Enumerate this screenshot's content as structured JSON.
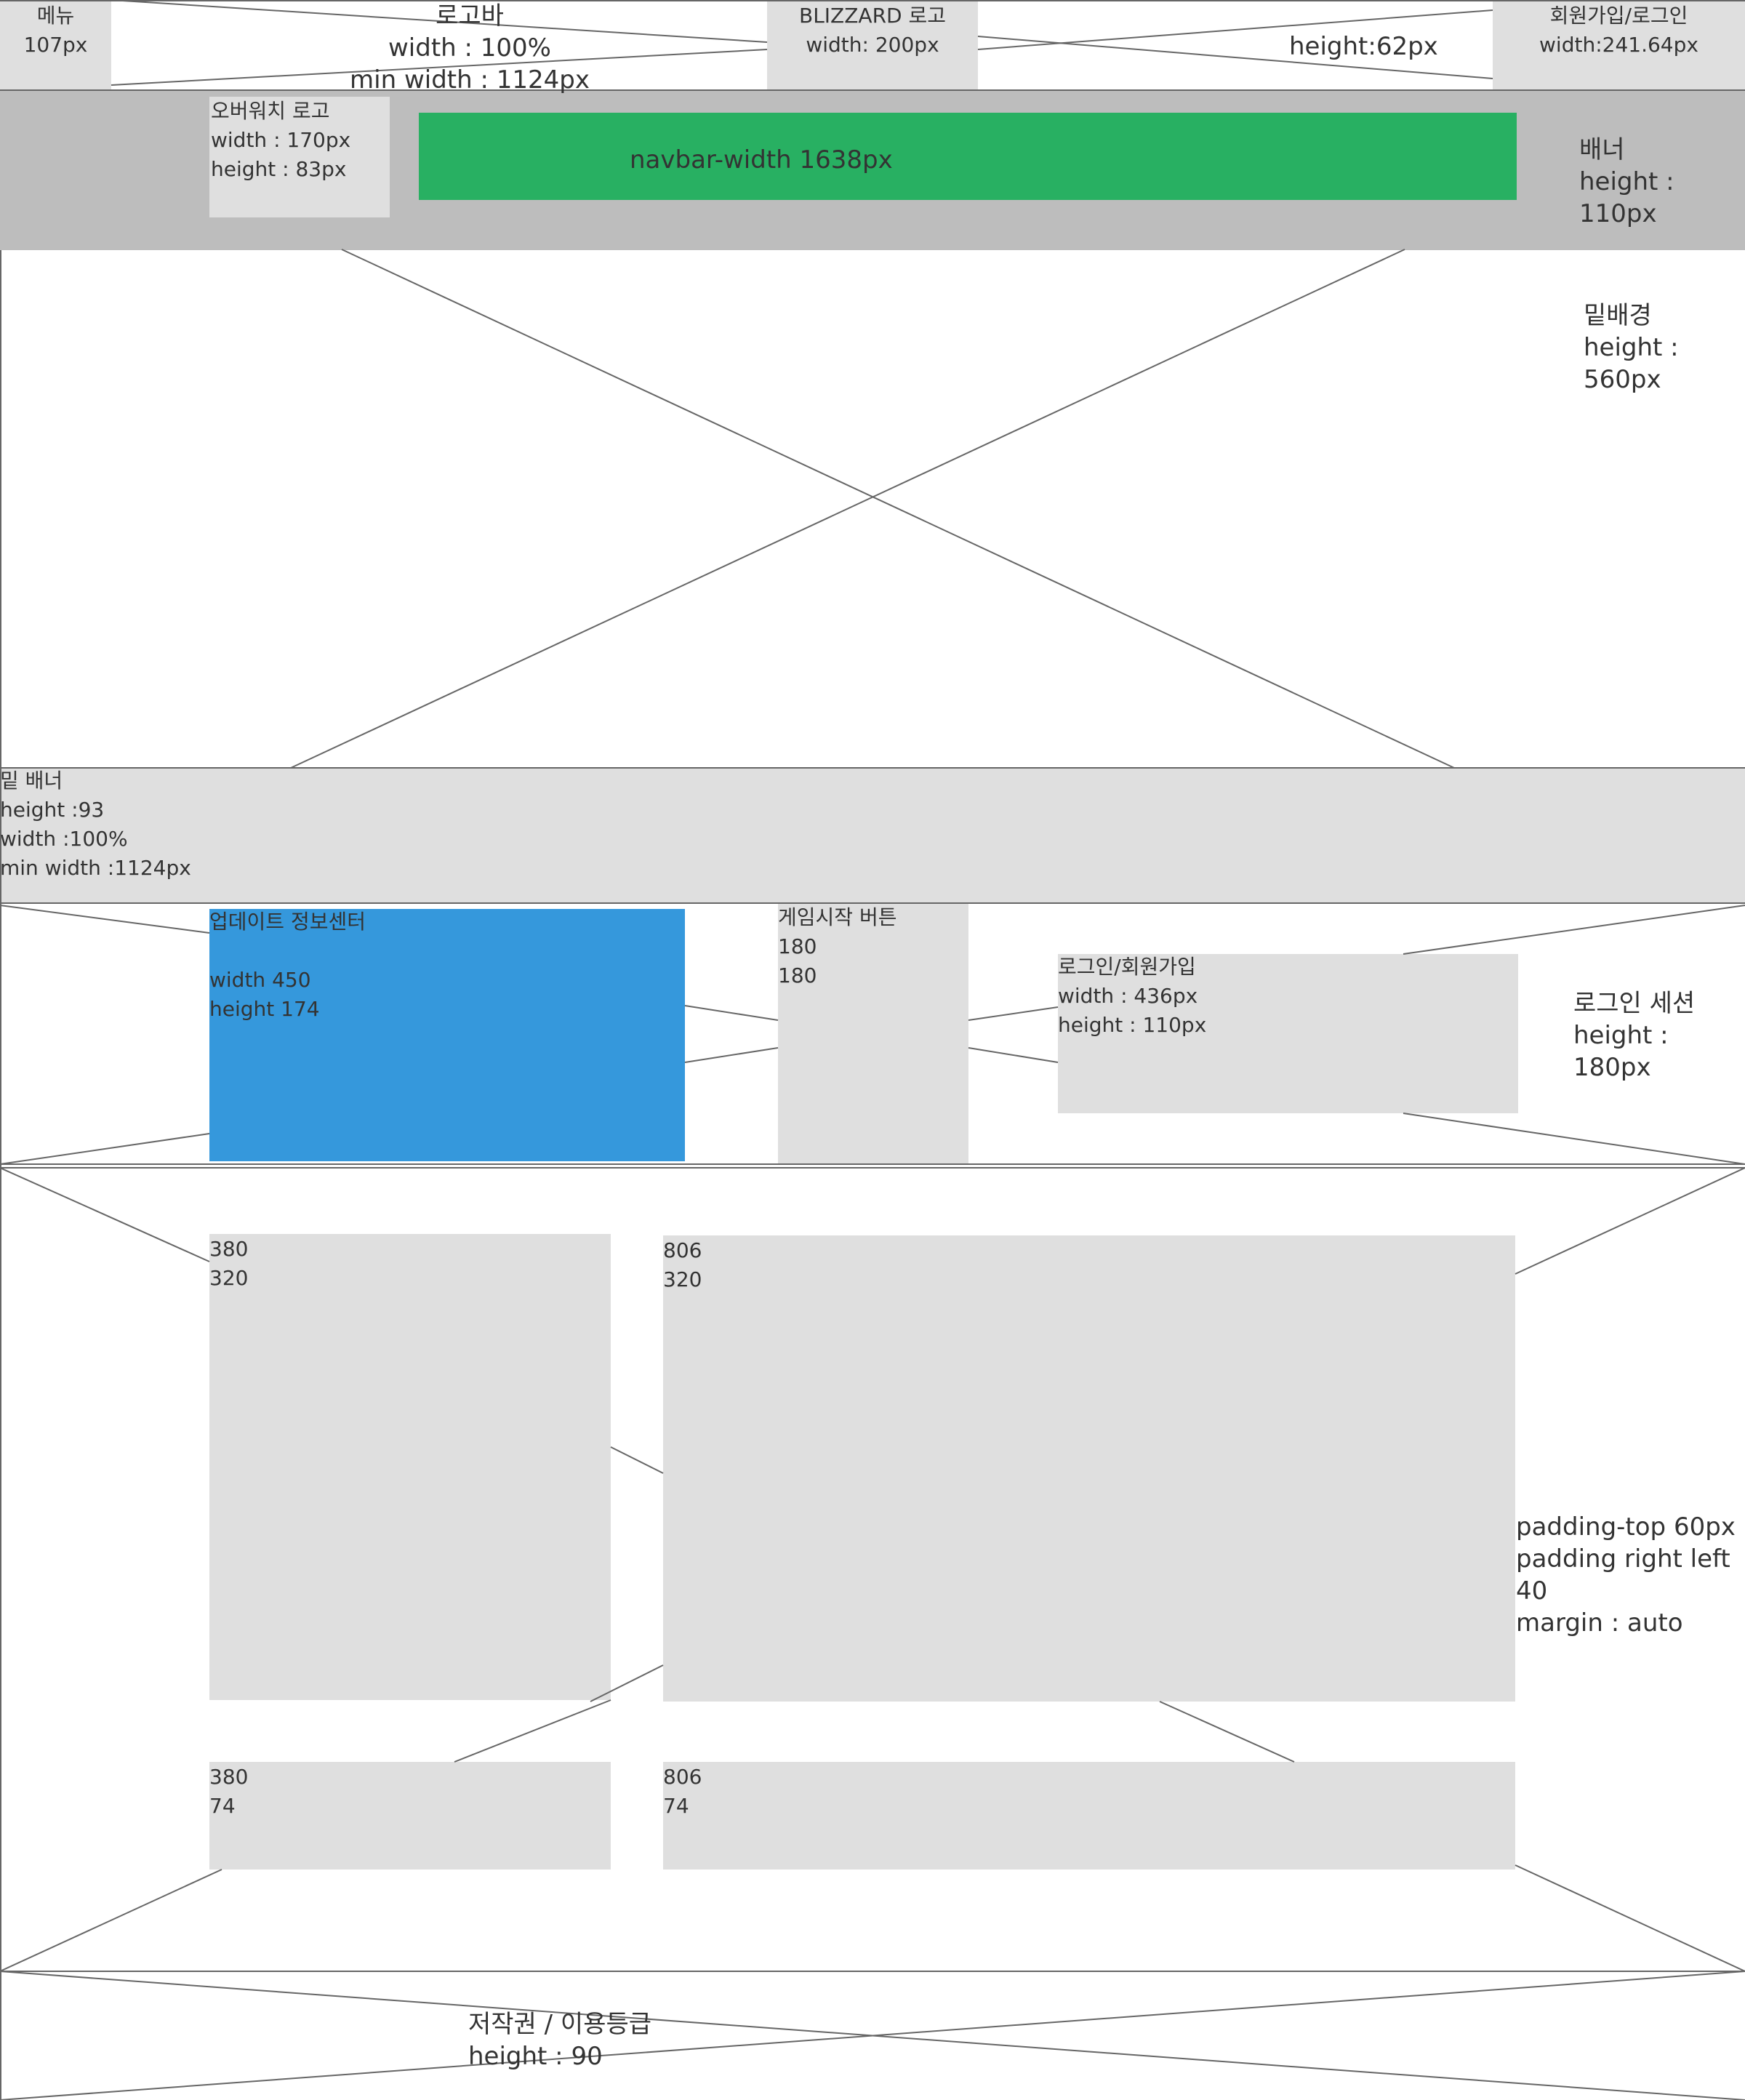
{
  "colors": {
    "box_fill": "#dfdfdf",
    "banner_fill": "#bdbdbd",
    "navbar_fill": "#28b062",
    "update_fill": "#3598dc",
    "stroke": "#666666",
    "text": "#333333"
  },
  "top_bar": {
    "menu": {
      "name": "메뉴",
      "size": "107px"
    },
    "logo_bar": {
      "name": "로고바",
      "width": "width : 100%",
      "min_width": "min width : 1124px"
    },
    "blizzard_logo": {
      "name": "BLIZZARD 로고",
      "width": "width: 200px"
    },
    "height_note": "height:62px",
    "signup_login": {
      "name": "회원가입/로그인",
      "width": "width:241.64px"
    }
  },
  "banner": {
    "overwatch_logo": {
      "name": "오버워치 로고",
      "width": "width : 170px",
      "height": "height : 83px"
    },
    "navbar": "navbar-width 1638px",
    "label": "배너",
    "height": "height : 110px"
  },
  "bottom_background": {
    "label": "밑배경",
    "height": "height : 560px"
  },
  "bottom_banner": {
    "label": "밑 배너",
    "height": "height :93",
    "width": "width :100%",
    "min_width": "min width :1124px"
  },
  "login_section": {
    "update_center": {
      "name": "업데이트 정보센터",
      "width": "width 450",
      "height": "height 174"
    },
    "game_start": {
      "name": "게임시작 버튼",
      "width": "180",
      "height": "180"
    },
    "login_box": {
      "name": "로그인/회원가입",
      "width": "width : 436px",
      "height": "height : 110px"
    },
    "label": "로그인 세션",
    "height": "height : 180px"
  },
  "content_section": {
    "boxes": [
      {
        "w": "380",
        "h": "320"
      },
      {
        "w": "806",
        "h": "320"
      },
      {
        "w": "380",
        "h": "74"
      },
      {
        "w": "806",
        "h": "74"
      }
    ],
    "padding_top": "padding-top 60px",
    "padding_sides": "padding right left 40",
    "margin": "margin : auto"
  },
  "footer": {
    "label": "저작권 / 이용등급",
    "height": "height : 90"
  }
}
